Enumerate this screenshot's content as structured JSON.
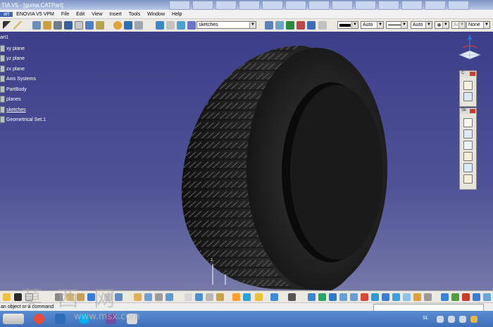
{
  "titlebar": {
    "title": "TIA V5 - [guma.CATPart]"
  },
  "menubar": {
    "items": [
      "art",
      "ENOVIA V5 VPM",
      "File",
      "Edit",
      "View",
      "Insert",
      "Tools",
      "Window",
      "Help"
    ]
  },
  "toolbar": {
    "sketch_select": "sketches",
    "color_select": "",
    "auto_select_1": "Auto",
    "auto_select_2": "Auto",
    "layer_select": "Aut",
    "none_select": "None"
  },
  "tree": {
    "items": [
      {
        "label": "art1",
        "indent": 0,
        "underlined": false
      },
      {
        "label": "xy plane",
        "indent": 1,
        "underlined": false
      },
      {
        "label": "yz plane",
        "indent": 1,
        "underlined": false
      },
      {
        "label": "zx plane",
        "indent": 1,
        "underlined": false
      },
      {
        "label": "Axis Systems",
        "indent": 1,
        "underlined": false
      },
      {
        "label": "PartBody",
        "indent": 1,
        "underlined": false
      },
      {
        "label": "planes",
        "indent": 1,
        "underlined": false
      },
      {
        "label": "sketches",
        "indent": 1,
        "underlined": true
      },
      {
        "label": "Geometrical Set.1",
        "indent": 1,
        "underlined": false
      }
    ]
  },
  "panels": {
    "panel1_title": "C",
    "panel2_title": "Sk"
  },
  "axis_label": "z",
  "status": {
    "message": "an object or a command"
  },
  "taskbar": {
    "tray_lang": "SL"
  },
  "watermark": {
    "chars": "莫 西 网",
    "site": "www.msx.com"
  },
  "colors": {
    "viewport_top": "#3c3e88",
    "viewport_bottom": "#7679a8",
    "tire": "#1f1f1f",
    "title_bar": "#7d93c6",
    "taskbar": "#4a7cc5"
  }
}
